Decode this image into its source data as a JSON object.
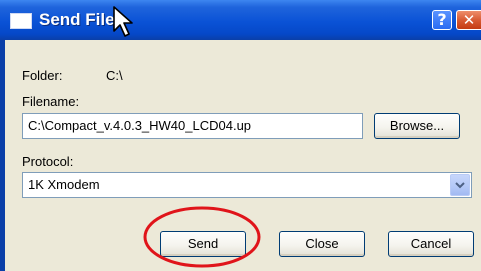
{
  "dialog": {
    "title": "Send File",
    "help_glyph": "?",
    "close_glyph": "✕"
  },
  "folder": {
    "label": "Folder:",
    "value": "C:\\"
  },
  "filename": {
    "label": "Filename:",
    "value": "C:\\Compact_v.4.0.3_HW40_LCD04.up",
    "browse_label": "Browse..."
  },
  "protocol": {
    "label": "Protocol:",
    "selected": "1K Xmodem"
  },
  "buttons": {
    "send": "Send",
    "close": "Close",
    "cancel": "Cancel"
  },
  "annotation": {
    "color": "#e0141a"
  },
  "colors": {
    "titlebar": "#0a52d6",
    "dialog_bg": "#ece9d8",
    "close_button": "#d85b34"
  }
}
